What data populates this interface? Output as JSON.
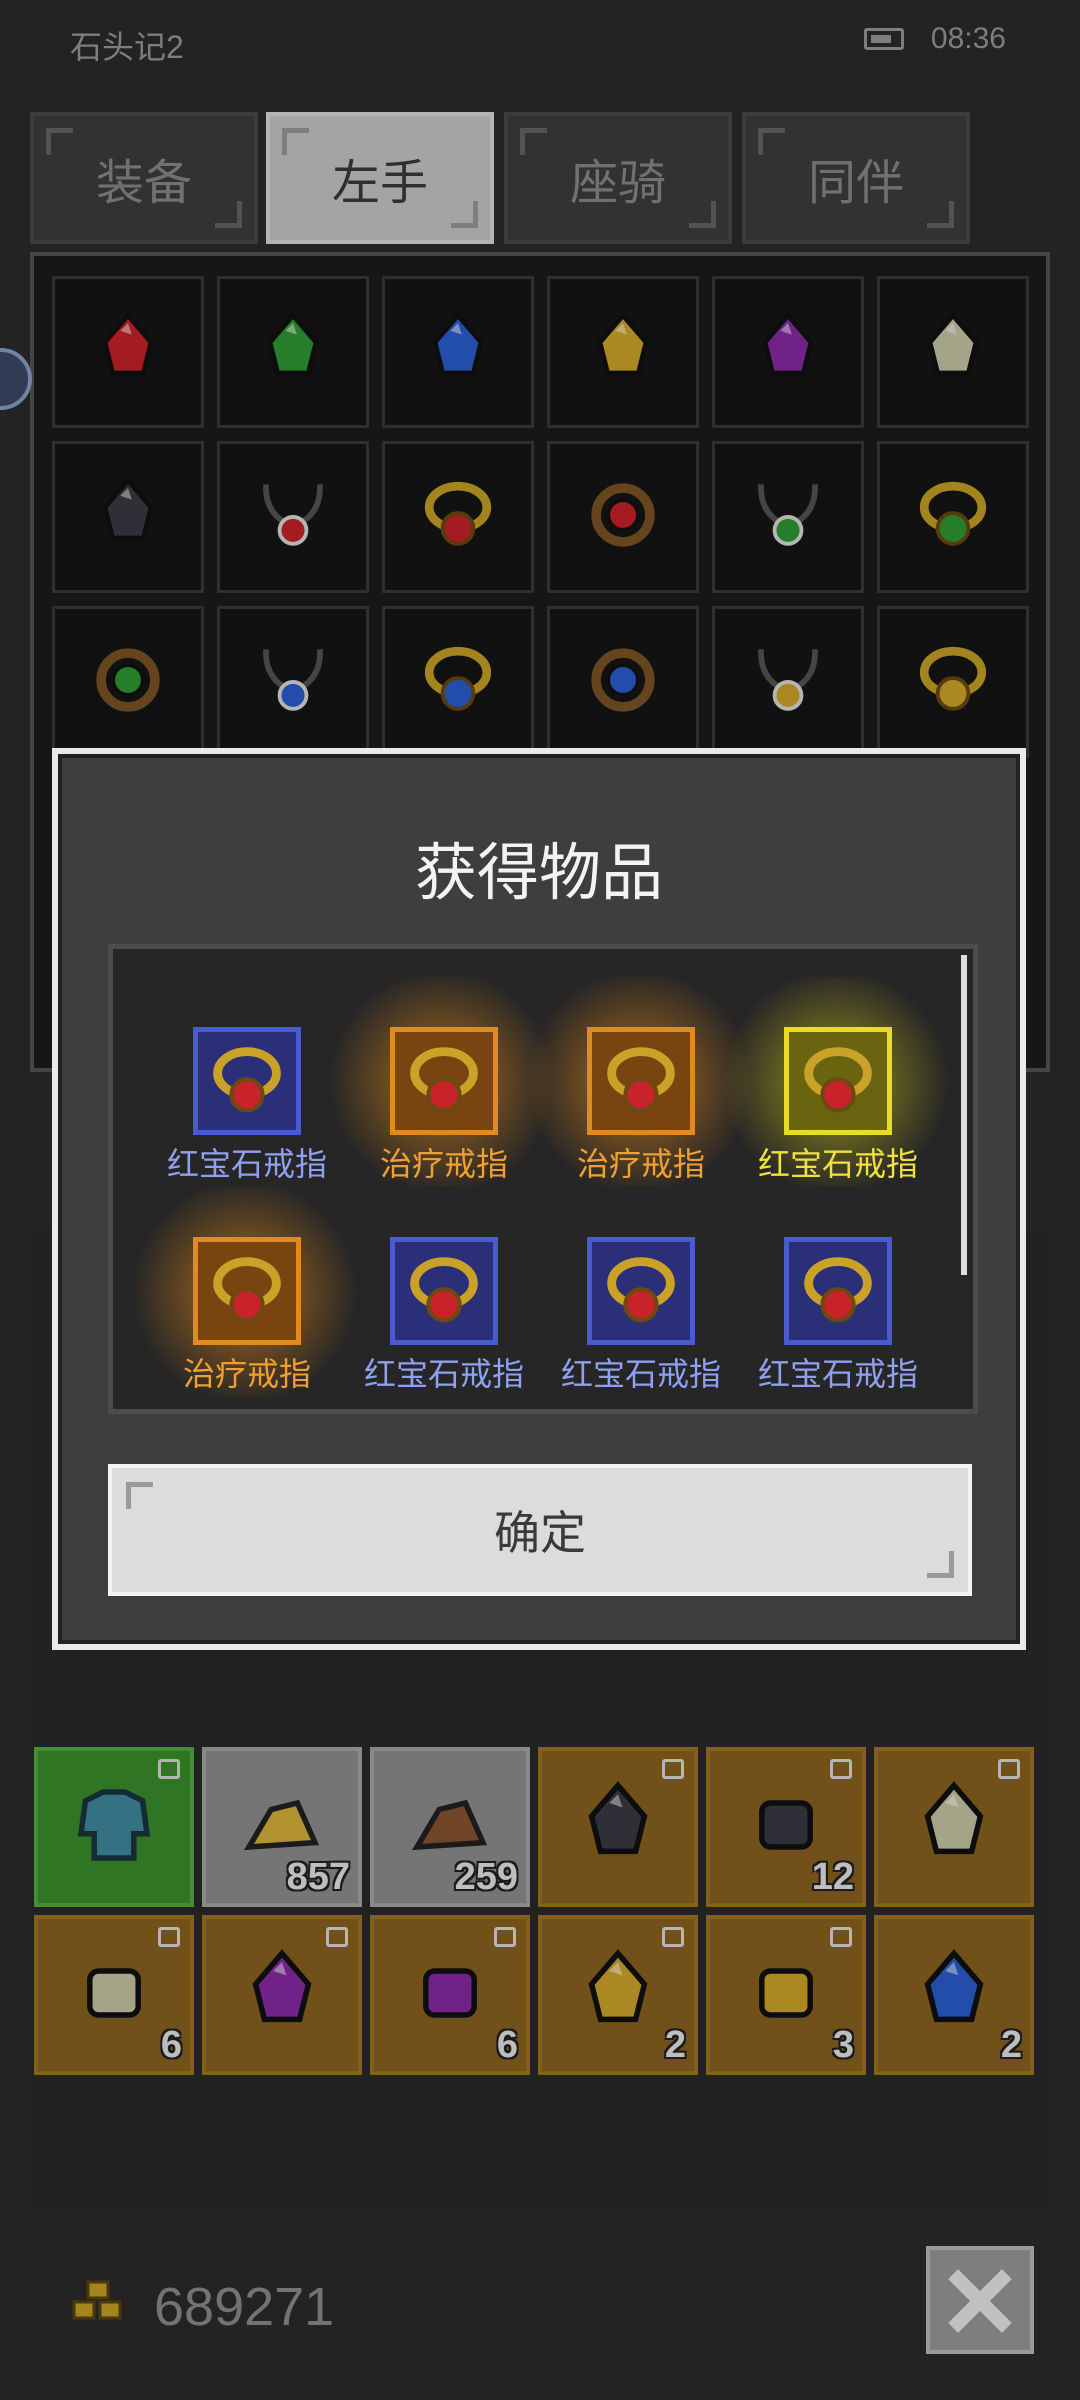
{
  "status_bar": {
    "app_title": "石头记2",
    "time": "08:36"
  },
  "tabs": [
    {
      "label": "装备",
      "active": false
    },
    {
      "label": "左手",
      "active": true
    },
    {
      "label": "座骑",
      "active": false
    },
    {
      "label": "同伴",
      "active": false
    }
  ],
  "upper_grid": {
    "rows": [
      [
        "red-gem-icon",
        "green-gem-icon",
        "blue-gem-icon",
        "yellow-gem-icon",
        "purple-gem-icon",
        "white-gem-icon"
      ],
      [
        "black-gem-icon",
        "red-necklace-icon",
        "red-ring-icon",
        "red-amulet-icon",
        "green-necklace-icon",
        "green-ring-icon"
      ],
      [
        "green-amulet-icon",
        "blue-necklace-icon",
        "blue-ring-icon",
        "blue-amulet-icon",
        "yellow-necklace-icon",
        "yellow-ring-icon"
      ]
    ]
  },
  "modal": {
    "title": "获得物品",
    "items": [
      {
        "label": "红宝石戒指",
        "rarity": "blue"
      },
      {
        "label": "治疗戒指",
        "rarity": "orange"
      },
      {
        "label": "治疗戒指",
        "rarity": "orange"
      },
      {
        "label": "红宝石戒指",
        "rarity": "yellow"
      },
      {
        "label": "治疗戒指",
        "rarity": "orange"
      },
      {
        "label": "红宝石戒指",
        "rarity": "blue"
      },
      {
        "label": "红宝石戒指",
        "rarity": "blue"
      },
      {
        "label": "红宝石戒指",
        "rarity": "blue"
      }
    ],
    "confirm_label": "确定"
  },
  "inventory": {
    "row1": [
      {
        "bg": "green",
        "icon": "chest-armor-icon",
        "count": "",
        "locked": true
      },
      {
        "bg": "gray",
        "icon": "gold-ore-icon",
        "count": "857",
        "locked": false
      },
      {
        "bg": "gray",
        "icon": "copper-ore-icon",
        "count": "259",
        "locked": false
      },
      {
        "bg": "orange",
        "icon": "black-gem-icon",
        "count": "",
        "locked": true
      },
      {
        "bg": "orange",
        "icon": "black-stone-icon",
        "count": "12",
        "locked": true
      },
      {
        "bg": "orange",
        "icon": "white-gem-icon",
        "count": "",
        "locked": true
      }
    ],
    "row2": [
      {
        "bg": "orange",
        "icon": "white-stone-icon",
        "count": "6",
        "locked": true
      },
      {
        "bg": "orange",
        "icon": "purple-gem-icon",
        "count": "",
        "locked": true
      },
      {
        "bg": "orange",
        "icon": "purple-stone-icon",
        "count": "6",
        "locked": true
      },
      {
        "bg": "orange",
        "icon": "yellow-gem-icon",
        "count": "2",
        "locked": true
      },
      {
        "bg": "orange",
        "icon": "yellow-stone-icon",
        "count": "3",
        "locked": true
      },
      {
        "bg": "orange",
        "icon": "blue-gem-icon",
        "count": "2",
        "locked": false
      }
    ]
  },
  "footer": {
    "gold_amount": "689271"
  },
  "colors": {
    "rarity_blue": "#4a5bd0",
    "rarity_orange": "#e08a20",
    "rarity_yellow": "#e8dc24"
  }
}
